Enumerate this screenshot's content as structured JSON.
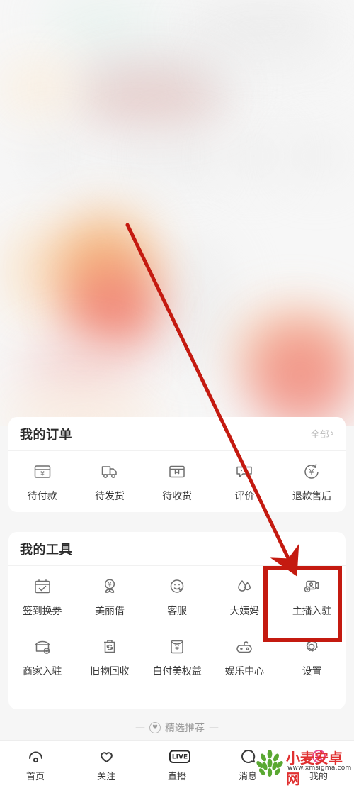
{
  "orders": {
    "title": "我的订单",
    "all_label": "全部",
    "all_chevron": "›",
    "items": [
      {
        "label": "待付款",
        "icon": "card-yen-icon"
      },
      {
        "label": "待发货",
        "icon": "truck-icon"
      },
      {
        "label": "待收货",
        "icon": "box-icon"
      },
      {
        "label": "评价",
        "icon": "comment-dots-icon"
      },
      {
        "label": "退款售后",
        "icon": "refund-yen-icon"
      }
    ]
  },
  "tools": {
    "title": "我的工具",
    "row1": [
      {
        "label": "签到换券",
        "icon": "calendar-check-icon"
      },
      {
        "label": "美丽借",
        "icon": "yen-sprout-icon"
      },
      {
        "label": "客服",
        "icon": "headset-smiley-icon"
      },
      {
        "label": "大姨妈",
        "icon": "water-drops-icon"
      },
      {
        "label": "主播入驻",
        "icon": "streamer-camera-icon"
      }
    ],
    "row2": [
      {
        "label": "商家入驻",
        "icon": "shop-plus-icon"
      },
      {
        "label": "旧物回收",
        "icon": "recycle-bin-icon"
      },
      {
        "label": "白付美权益",
        "icon": "envelope-yen-icon"
      },
      {
        "label": "娱乐中心",
        "icon": "gamepad-icon"
      },
      {
        "label": "设置",
        "icon": "gear-icon"
      }
    ]
  },
  "featured": {
    "dash_left": "—",
    "dash_right": "—",
    "heart": "♥",
    "label": "精选推荐"
  },
  "tabbar": [
    {
      "label": "首页",
      "icon": "home-icon"
    },
    {
      "label": "关注",
      "icon": "heart-icon"
    },
    {
      "label": "直播",
      "icon": "live-tv-icon",
      "badge_text": "LIVE"
    },
    {
      "label": "消息",
      "icon": "message-bubble-icon"
    },
    {
      "label": "我的",
      "icon": "profile-icon"
    }
  ],
  "annotation": {
    "highlight_target": "主播入驻",
    "color": "#c41a10",
    "arrow_from": "180,317",
    "arrow_to": "412,795"
  },
  "watermark": {
    "name": "小麦安卓网",
    "url": "www.xmsigma.com",
    "logo": "wheat-logo"
  },
  "colors": {
    "accent_red": "#c41a10",
    "card_bg": "#ffffff",
    "page_bg": "#f6f6f6",
    "label_text": "#3a3a3a",
    "muted_text": "#b9b9b9"
  }
}
